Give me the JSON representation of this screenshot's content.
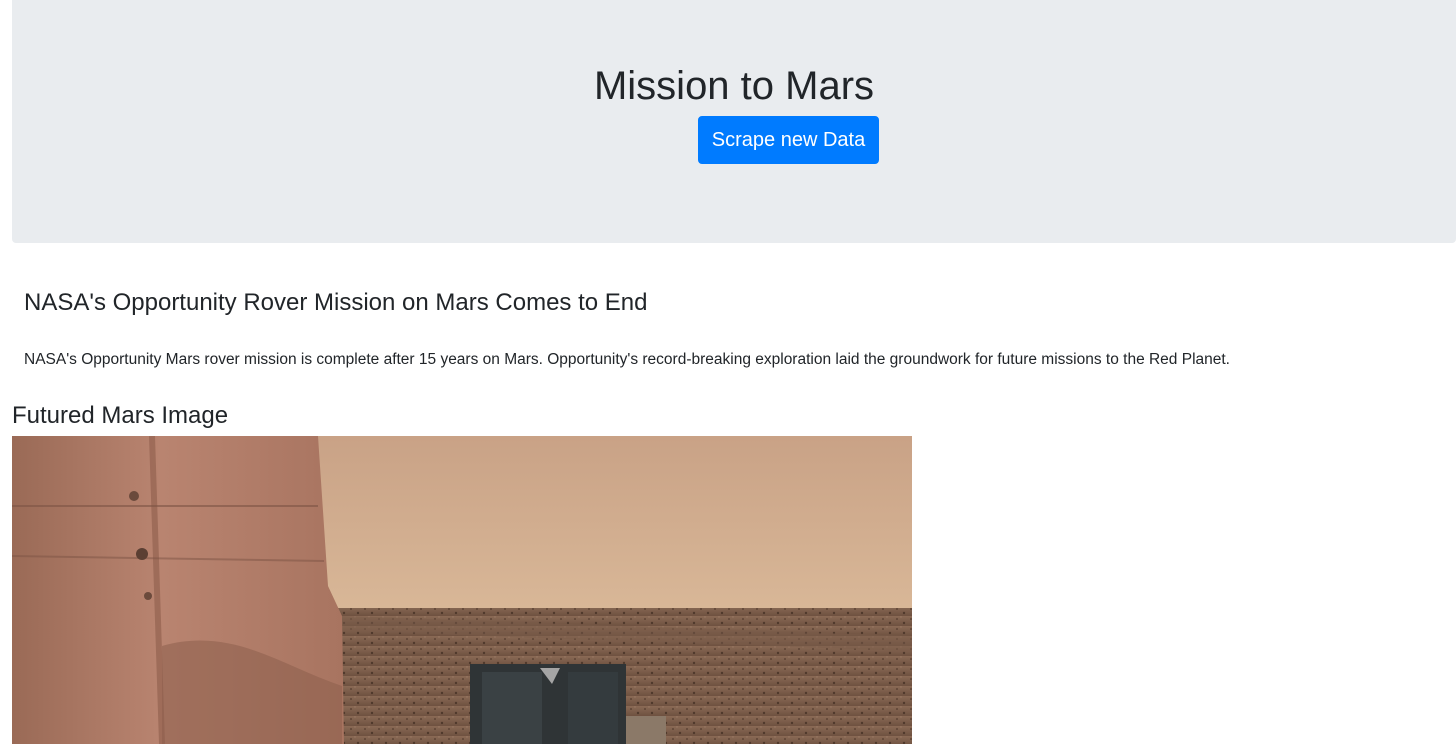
{
  "header": {
    "title": "Mission to Mars",
    "scrape_button_label": "Scrape new Data"
  },
  "news": {
    "title": "NASA's Opportunity Rover Mission on Mars Comes to End",
    "teaser": "NASA's Opportunity Mars rover mission is complete after 15 years on Mars. Opportunity's record-breaking exploration laid the groundwork for future missions to the Red Planet."
  },
  "featured": {
    "heading": "Futured Mars Image"
  },
  "colors": {
    "jumbotron_bg": "#e9ecef",
    "button_primary": "#007bff",
    "text": "#212529"
  }
}
